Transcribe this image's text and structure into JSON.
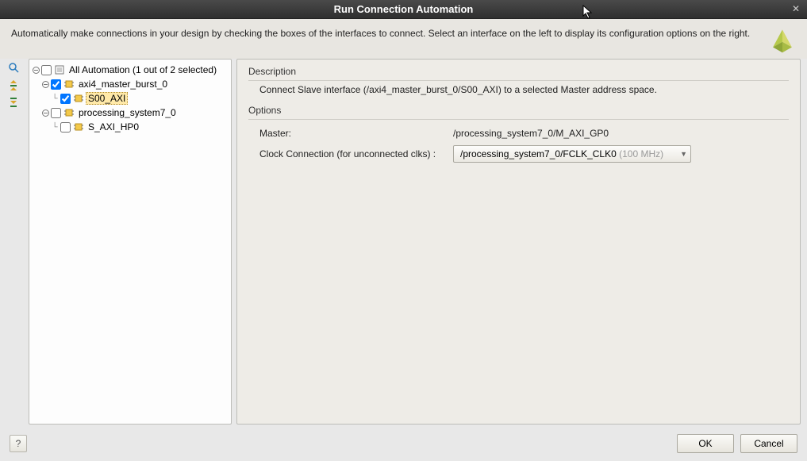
{
  "window": {
    "title": "Run Connection Automation"
  },
  "header": {
    "text": "Automatically make connections in your design by checking the boxes of the interfaces to connect. Select an interface on the left to display its configuration options on the right."
  },
  "tree": {
    "root_label": "All Automation (1 out of 2 selected)",
    "items": [
      {
        "label": "axi4_master_burst_0",
        "checked": true,
        "children": [
          {
            "label": "S00_AXI",
            "checked": true,
            "selected": true
          }
        ]
      },
      {
        "label": "processing_system7_0",
        "checked": false,
        "children": [
          {
            "label": "S_AXI_HP0",
            "checked": false,
            "selected": false
          }
        ]
      }
    ]
  },
  "details": {
    "description_title": "Description",
    "description_text": "Connect Slave interface (/axi4_master_burst_0/S00_AXI) to a selected Master address space.",
    "options_title": "Options",
    "master_label": "Master:",
    "master_value": "/processing_system7_0/M_AXI_GP0",
    "clock_label": "Clock Connection (for unconnected clks) :",
    "clock_value": "/processing_system7_0/FCLK_CLK0",
    "clock_hint": "(100 MHz)"
  },
  "footer": {
    "help": "?",
    "ok": "OK",
    "cancel": "Cancel"
  }
}
